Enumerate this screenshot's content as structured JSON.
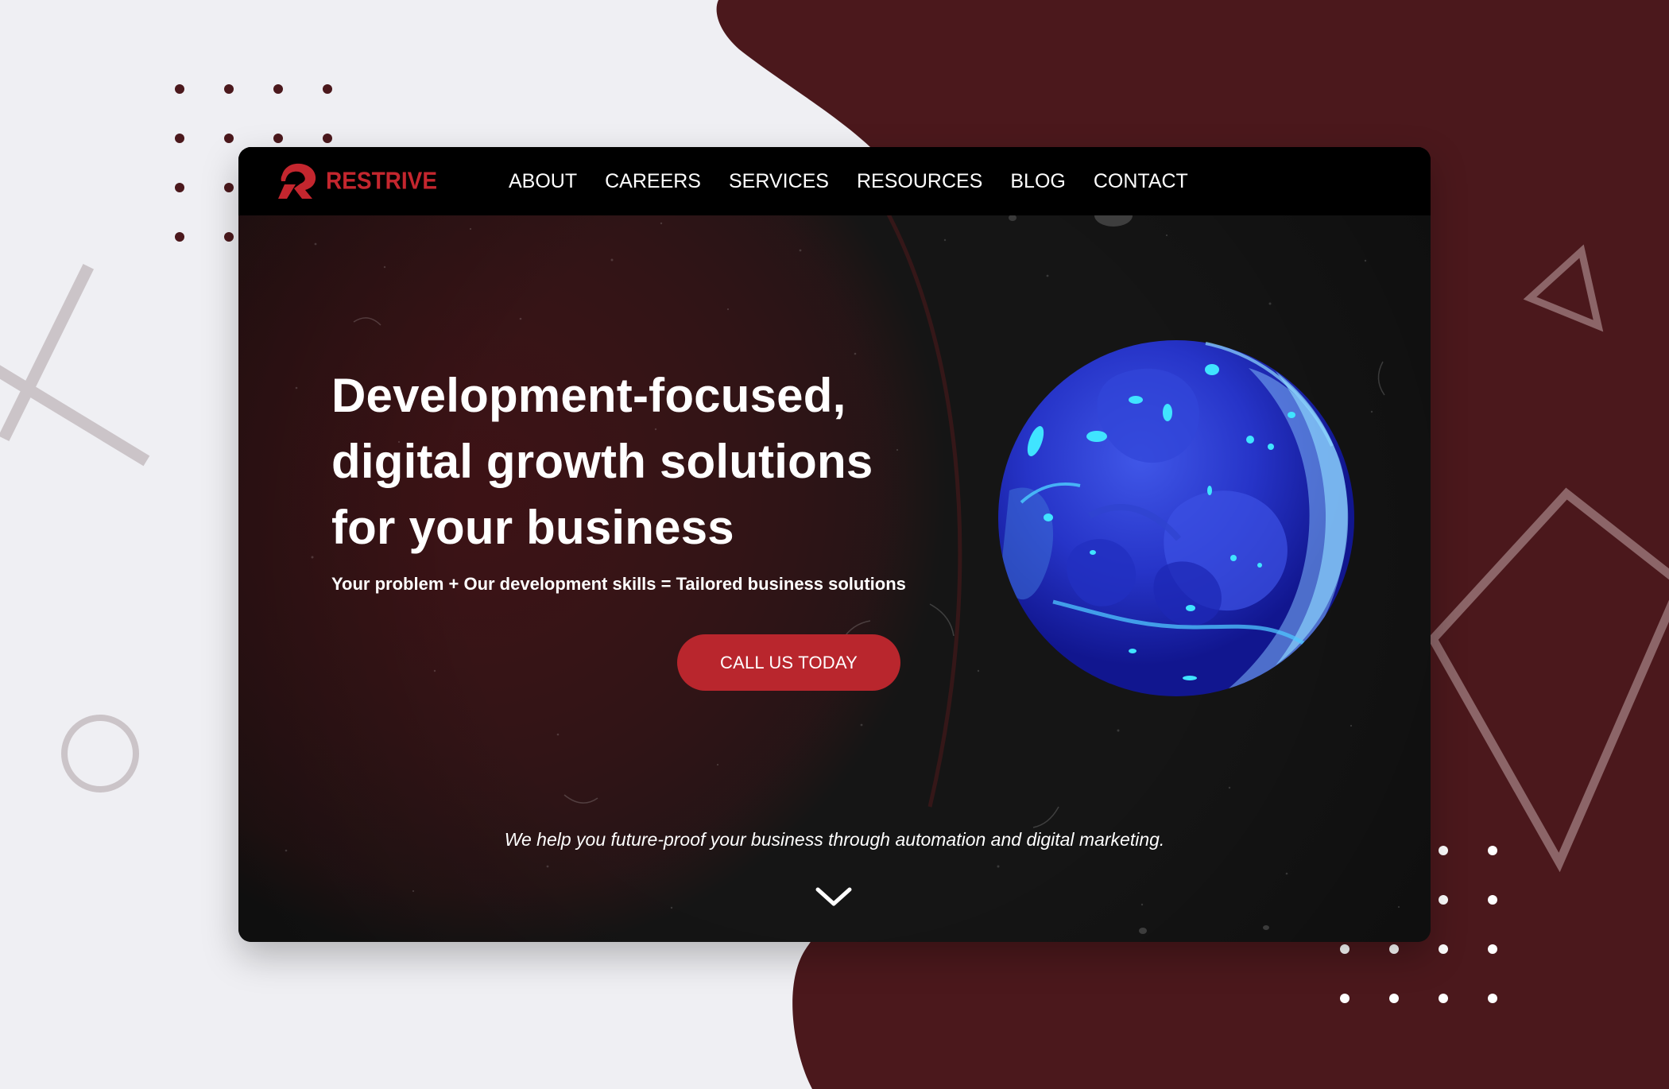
{
  "brand": {
    "name": "RESTRIVE",
    "logo_icon": "restrive-r-logo-icon",
    "color": "#c4262e"
  },
  "nav": {
    "items": [
      {
        "label": "ABOUT"
      },
      {
        "label": "CAREERS"
      },
      {
        "label": "SERVICES"
      },
      {
        "label": "RESOURCES"
      },
      {
        "label": "BLOG"
      },
      {
        "label": "CONTACT"
      }
    ]
  },
  "hero": {
    "title_lines": [
      "Development-focused,",
      "digital growth solutions",
      "for your business"
    ],
    "subtitle": "Your problem + Our development skills = Tailored business solutions",
    "cta_label": "CALL US TODAY",
    "tagline": "We help you future-proof your business through automation and digital marketing.",
    "planet_image": "blue-planet",
    "scroll_icon": "chevron-down-icon"
  },
  "theme": {
    "page_background": "#efeff3",
    "accent_maroon": "#4b181c",
    "button_red": "#b9262d",
    "hero_background": "#151515"
  }
}
